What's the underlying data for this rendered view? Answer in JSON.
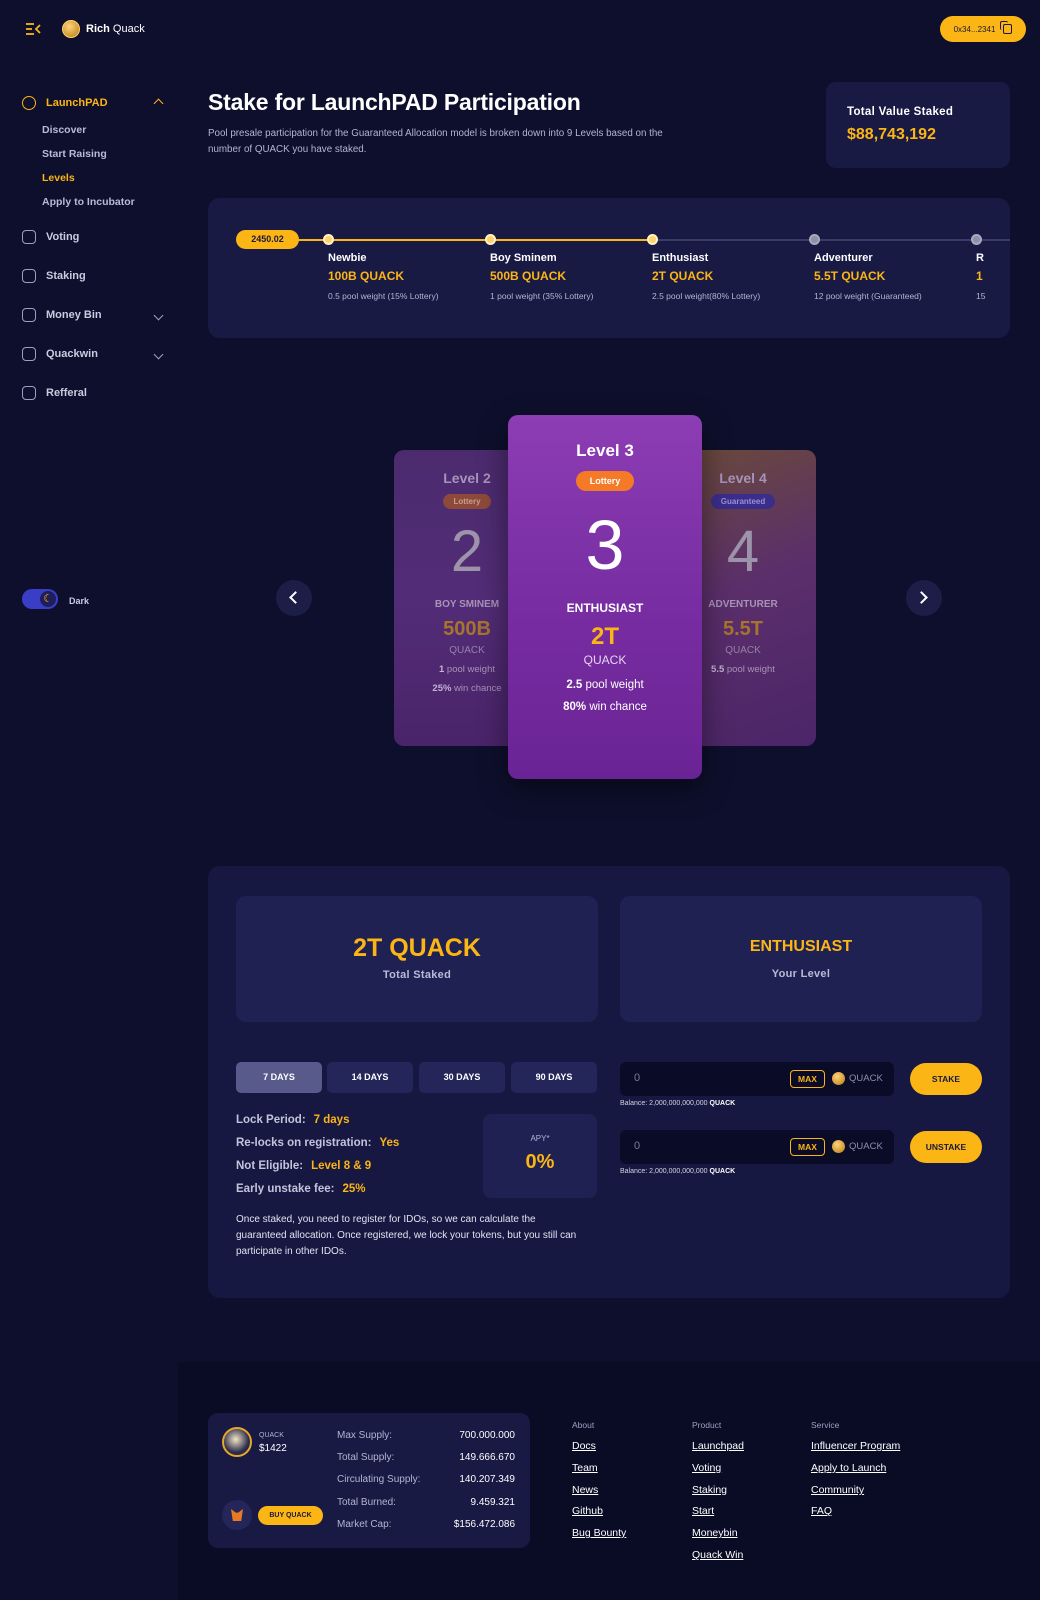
{
  "app": {
    "brand_bold": "Rich",
    "brand_light": "Quack",
    "wallet_address": "0x34...2341"
  },
  "sidebar": {
    "launchpad": "LaunchPAD",
    "sub_items": [
      "Discover",
      "Start Raising",
      "Levels",
      "Apply to Incubator"
    ],
    "items": [
      "Voting",
      "Staking",
      "Money Bin",
      "Quackwin",
      "Refferal"
    ],
    "theme_label": "Dark"
  },
  "header": {
    "title": "Stake for LaunchPAD Participation",
    "description": "Pool presale participation for the Guaranteed Allocation model is broken down into 9 Levels based on the number of QUACK you have staked.",
    "tvs_label": "Total Value Staked",
    "tvs_value": "$88,743,192"
  },
  "timeline": {
    "current": "2450.02",
    "progress_steps_reached": 3,
    "steps": [
      {
        "name": "Newbie",
        "amount": "100B QUACK",
        "weight": "0.5 pool weight (15% Lottery)"
      },
      {
        "name": "Boy Sminem",
        "amount": "500B QUACK",
        "weight": "1 pool weight (35% Lottery)"
      },
      {
        "name": "Enthusiast",
        "amount": "2T QUACK",
        "weight": "2.5 pool weight(80% Lottery)"
      },
      {
        "name": "Adventurer",
        "amount": "5.5T QUACK",
        "weight": "12 pool weight (Guaranteed)"
      },
      {
        "name": "R",
        "amount": "1",
        "weight": "15"
      }
    ]
  },
  "cards": {
    "l2": {
      "level": "Level 2",
      "tag": "Lottery",
      "num": "2",
      "name": "BOY SMINEM",
      "amount": "500B",
      "unit": "QUACK",
      "pw_b": "1",
      "pw": " pool weight",
      "wc_b": "25%",
      "wc": " win chance"
    },
    "l3": {
      "level": "Level 3",
      "tag": "Lottery",
      "num": "3",
      "name": "ENTHUSIAST",
      "amount": "2T",
      "unit": "QUACK",
      "pw_b": "2.5",
      "pw": " pool weight",
      "wc_b": "80%",
      "wc": " win chance"
    },
    "l4": {
      "level": "Level 4",
      "tag": "Guaranteed",
      "num": "4",
      "name": "ADVENTURER",
      "amount": "5.5T",
      "unit": "QUACK",
      "pw_b": "5.5",
      "pw": " pool weight"
    }
  },
  "stake": {
    "total_value": "2T QUACK",
    "total_label": "Total Staked",
    "level_value": "ENTHUSIAST",
    "level_label": "Your Level",
    "durations": [
      "7 DAYS",
      "14 DAYS",
      "30 DAYS",
      "90 DAYS"
    ],
    "selected_duration": "7 DAYS",
    "info": [
      {
        "label": "Lock Period:",
        "value": "7 days"
      },
      {
        "label": "Re-locks on registration:",
        "value": "Yes"
      },
      {
        "label": "Not Eligible:",
        "value": "Level 8 & 9"
      },
      {
        "label": "Early unstake fee:",
        "value": "25%"
      }
    ],
    "apy_label": "APY*",
    "apy_value": "0%",
    "note": "Once staked, you need to register for IDOs, so we can calculate the guaranteed allocation. Once registered, we lock your tokens, but you still can participate in other IDOs.",
    "stake_input": "0",
    "unstake_input": "0",
    "max_label": "MAX",
    "token": "QUACK",
    "balance_label": "Balance: 2,000,000,000,000 ",
    "balance_token": "QUACK",
    "stake_btn": "STAKE",
    "unstake_btn": "UNSTAKE"
  },
  "footer": {
    "token_name": "QUACK",
    "token_price": "$1422",
    "buy_btn": "BUY QUACK",
    "supply": [
      {
        "label": "Max Supply:",
        "value": "700.000.000"
      },
      {
        "label": "Total Supply:",
        "value": "149.666.670"
      },
      {
        "label": "Circulating Supply:",
        "value": "140.207.349"
      },
      {
        "label": "Total Burned:",
        "value": "9.459.321"
      },
      {
        "label": "Market Cap:",
        "value": "$156.472.086"
      }
    ],
    "cols": [
      {
        "head": "About",
        "links": [
          "Docs",
          "Team",
          "News",
          "Github",
          "Bug Bounty"
        ]
      },
      {
        "head": "Product",
        "links": [
          "Launchpad",
          "Voting",
          "Staking",
          "Start",
          "Moneybin",
          "Quack Win"
        ]
      },
      {
        "head": "Service",
        "links": [
          "Influencer Program",
          "Apply to Launch",
          "Community",
          "FAQ"
        ]
      }
    ]
  },
  "colors": {
    "accent": "#fbb515",
    "bg": "#0e0f2c",
    "panel": "#181a44",
    "card_active": "#8d3db4"
  },
  "icons": [
    "menu-collapse-icon",
    "duck-logo-icon",
    "copy-icon",
    "rocket-icon",
    "vote-icon",
    "staking-icon",
    "money-bin-icon",
    "star-icon",
    "referral-icon",
    "moon-icon",
    "chevron-left-icon",
    "chevron-right-icon",
    "quack-coin-icon",
    "metamask-icon"
  ]
}
